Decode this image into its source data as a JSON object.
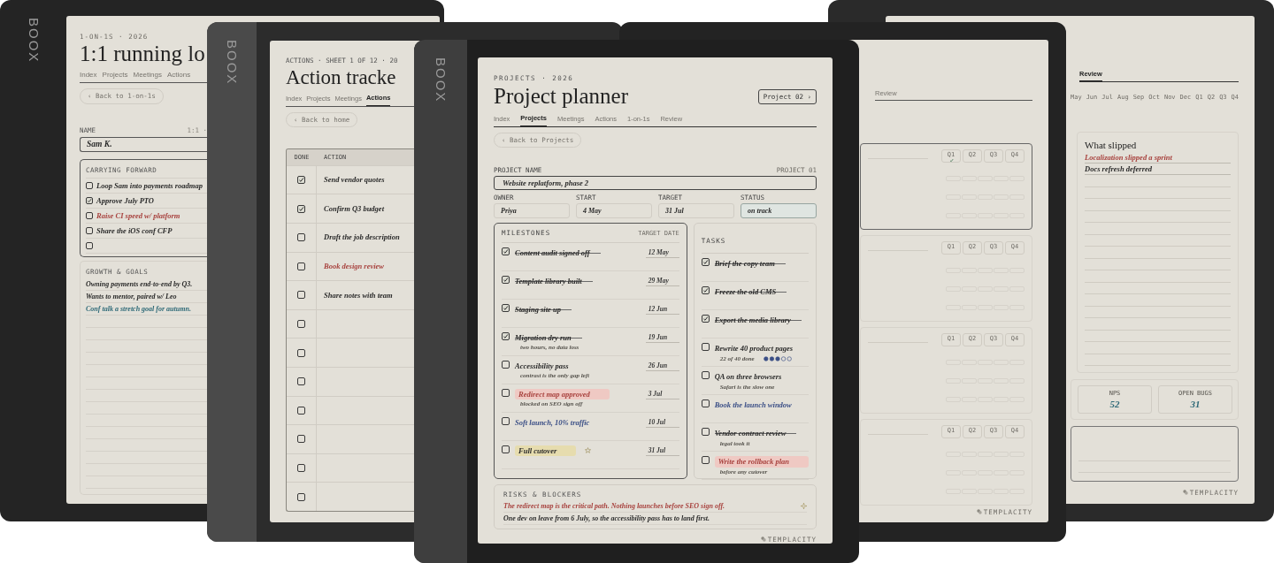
{
  "devices": [
    {
      "kind": "one_on_one",
      "brand": "BOOX",
      "eyebrow": "1-ON-1S · 2026",
      "title": "1:1 running lo",
      "tabs": [
        {
          "label": "Index",
          "selected": false
        },
        {
          "label": "Projects",
          "selected": false
        },
        {
          "label": "Meetings",
          "selected": false
        },
        {
          "label": "Actions",
          "selected": false
        }
      ],
      "back_button": "‹ Back to 1-on-1s",
      "name_label": "NAME",
      "name_meta": "1:1 ·",
      "name_value": "Sam K.",
      "carrying_forward": {
        "heading": "CARRYING FORWARD",
        "items": [
          {
            "text": "Loop Sam into payments roadmap",
            "checked": false,
            "color": "#2b2b2b"
          },
          {
            "text": "Approve July PTO",
            "checked": true,
            "color": "#2b2b2b"
          },
          {
            "text": "Raise CI speed w/ platform",
            "checked": false,
            "color": "#a8433f"
          },
          {
            "text": "Share the iOS conf CFP",
            "checked": false,
            "color": "#2b2b2b"
          },
          {
            "checked": false
          }
        ]
      },
      "growth": {
        "heading": "GROWTH & GOALS",
        "lines": [
          {
            "text": "Owning payments end-to-end by Q3.",
            "color": "#2b2b2b"
          },
          {
            "text": "Wants to mentor, paired w/ Leo",
            "color": "#2b2b2b"
          },
          {
            "text": "Conf talk a stretch goal for autumn.",
            "color": "#2f6a78"
          }
        ]
      }
    },
    {
      "kind": "actions",
      "brand": "BOOX",
      "eyebrow": "ACTIONS · SHEET 1 OF 12 · 20",
      "title": "Action tracke",
      "tabs": [
        {
          "label": "Index",
          "selected": false
        },
        {
          "label": "Projects",
          "selected": false
        },
        {
          "label": "Meetings",
          "selected": false
        },
        {
          "label": "Actions",
          "selected": true
        }
      ],
      "back_button": "‹ Back to home",
      "columns": [
        "DONE",
        "ACTION"
      ],
      "rows": [
        {
          "text": "Send vendor quotes",
          "checked": true,
          "color": "#2b2b2b"
        },
        {
          "text": "Confirm Q3 budget",
          "checked": true,
          "color": "#2b2b2b"
        },
        {
          "text": "Draft the job description",
          "checked": false,
          "color": "#2b2b2b"
        },
        {
          "text": "Book design review",
          "checked": false,
          "color": "#a8433f"
        },
        {
          "text": "Share notes with team",
          "checked": false,
          "color": "#2b2b2b"
        },
        {
          "checked": false
        },
        {
          "checked": false
        },
        {
          "checked": false
        },
        {
          "checked": false
        },
        {
          "checked": false
        },
        {
          "checked": false
        },
        {
          "checked": false
        }
      ]
    },
    {
      "kind": "planner",
      "brand": "BOOX",
      "eyebrow": "PROJECTS · 2026",
      "title": "Project planner",
      "next_button": "Project 02 ›",
      "tabs": [
        {
          "label": "Index",
          "selected": false
        },
        {
          "label": "Projects",
          "selected": true
        },
        {
          "label": "Meetings",
          "selected": false
        },
        {
          "label": "Actions",
          "selected": false
        },
        {
          "label": "1-on-1s",
          "selected": false
        },
        {
          "label": "Review",
          "selected": false
        }
      ],
      "back_button": "‹ Back to Projects",
      "project_label": "PROJECT NAME",
      "project_number": "PROJECT 01",
      "project_name": "Website replatform, phase 2",
      "fields": [
        {
          "kind": "text",
          "label": "OWNER",
          "value": "Priya"
        },
        {
          "kind": "text",
          "label": "START",
          "value": "4 May"
        },
        {
          "kind": "text",
          "label": "TARGET",
          "value": "31 Jul"
        },
        {
          "kind": "status",
          "label": "STATUS",
          "value": "on track"
        }
      ],
      "milestones": {
        "heading": "MILESTONES",
        "date_heading": "TARGET DATE",
        "items": [
          {
            "text": "Content audit signed off",
            "date": "12 May",
            "checked": true,
            "struck": true,
            "starred": false,
            "color": "#2b2b2b"
          },
          {
            "text": "Template library built",
            "date": "29 May",
            "checked": true,
            "struck": true,
            "starred": false,
            "color": "#2b2b2b"
          },
          {
            "text": "Staging site up",
            "date": "12 Jun",
            "checked": true,
            "struck": true,
            "starred": false,
            "color": "#2b2b2b"
          },
          {
            "text": "Migration dry run",
            "note": "two hours, no data loss",
            "date": "19 Jun",
            "checked": true,
            "struck": true,
            "starred": false,
            "color": "#2b2b2b"
          },
          {
            "text": "Accessibility pass",
            "note": "contrast is the only gap left",
            "date": "26 Jun",
            "checked": false,
            "struck": false,
            "starred": false,
            "color": "#2b2b2b"
          },
          {
            "text": "Redirect map approved",
            "note": "blocked on SEO sign off",
            "date": "3 Jul",
            "checked": false,
            "struck": false,
            "starred": false,
            "color": "#a8433f",
            "highlight": {
              "color": "#efc9c3"
            }
          },
          {
            "text": "Soft launch, 10% traffic",
            "date": "10 Jul",
            "checked": false,
            "struck": false,
            "starred": false,
            "color": "#3b4f86"
          },
          {
            "text": "Full cutover",
            "date": "31 Jul",
            "checked": false,
            "struck": false,
            "starred": true,
            "color": "#2b2b2b",
            "highlight": {
              "color": "#e6dcae"
            }
          }
        ]
      },
      "tasks": {
        "heading": "TASKS",
        "items": [
          {
            "text": "Brief the copy team",
            "checked": true,
            "struck": true,
            "color": "#2b2b2b"
          },
          {
            "text": "Freeze the old CMS",
            "checked": true,
            "struck": true,
            "color": "#2b2b2b"
          },
          {
            "text": "Export the media library",
            "checked": true,
            "struck": true,
            "color": "#2b2b2b"
          },
          {
            "text": "Rewrite 40 product pages",
            "note": "22 of 40 done",
            "level": 0.6,
            "checked": false,
            "struck": false,
            "color": "#2b2b2b"
          },
          {
            "text": "QA on three browsers",
            "note": "Safari is the slow one",
            "checked": false,
            "struck": false,
            "color": "#2b2b2b"
          },
          {
            "text": "Book the launch window",
            "checked": false,
            "struck": false,
            "color": "#3b4f86"
          },
          {
            "text": "Vendor contract review",
            "note": "legal took it",
            "checked": false,
            "struck": true,
            "color": "#2b2b2b"
          },
          {
            "text": "Write the rollback plan",
            "note": "before any cutover",
            "checked": false,
            "struck": false,
            "color": "#a8433f",
            "highlight": {
              "color": "#efc9c3"
            }
          }
        ]
      },
      "risks": {
        "heading": "RISKS & BLOCKERS",
        "lines": [
          {
            "text": "The redirect map is the critical path. Nothing launches before SEO sign off.",
            "color": "#a8433f"
          },
          {
            "text": "One dev on leave from 6 July, so the accessibility pass has to land first.",
            "color": "#2b2b2b"
          }
        ]
      },
      "footer_logo": "TEMPLACITY"
    },
    {
      "kind": "goals",
      "tabs": [
        {
          "label": "Review",
          "selected": false
        }
      ],
      "groups": [
        {
          "quarters": [
            {
              "label": "Q1",
              "checked": true
            },
            {
              "label": "Q2",
              "checked": false
            },
            {
              "label": "Q3",
              "checked": false
            },
            {
              "label": "Q4",
              "checked": false
            }
          ]
        },
        {
          "quarters": [
            {
              "label": "Q1",
              "checked": false
            },
            {
              "label": "Q2",
              "checked": false
            },
            {
              "label": "Q3",
              "checked": false
            },
            {
              "label": "Q4",
              "checked": false
            }
          ]
        },
        {
          "quarters": [
            {
              "label": "Q1",
              "checked": false
            },
            {
              "label": "Q2",
              "checked": false
            },
            {
              "label": "Q3",
              "checked": false
            },
            {
              "label": "Q4",
              "checked": false
            }
          ]
        },
        {
          "quarters": [
            {
              "label": "Q1",
              "checked": false
            },
            {
              "label": "Q2",
              "checked": false
            },
            {
              "label": "Q3",
              "checked": false
            },
            {
              "label": "Q4",
              "checked": false
            }
          ]
        }
      ],
      "footer_logo": "TEMPLACITY"
    },
    {
      "kind": "review",
      "tabs": [
        {
          "label": "Review",
          "selected": true
        }
      ],
      "months": [
        "May",
        "Jun",
        "Jul",
        "Aug",
        "Sep",
        "Oct",
        "Nov",
        "Dec",
        "Q1",
        "Q2",
        "Q3",
        "Q4"
      ],
      "slipped": {
        "title": "What slipped",
        "lines": [
          {
            "text": "Localization slipped a sprint",
            "color": "#a8433f"
          },
          {
            "text": "Docs refresh deferred",
            "color": "#2b2b2b"
          }
        ]
      },
      "metrics": [
        {
          "label": "NPS",
          "value": "52"
        },
        {
          "label": "OPEN BUGS",
          "value": "31"
        }
      ],
      "footer_logo": "TEMPLACITY"
    }
  ]
}
